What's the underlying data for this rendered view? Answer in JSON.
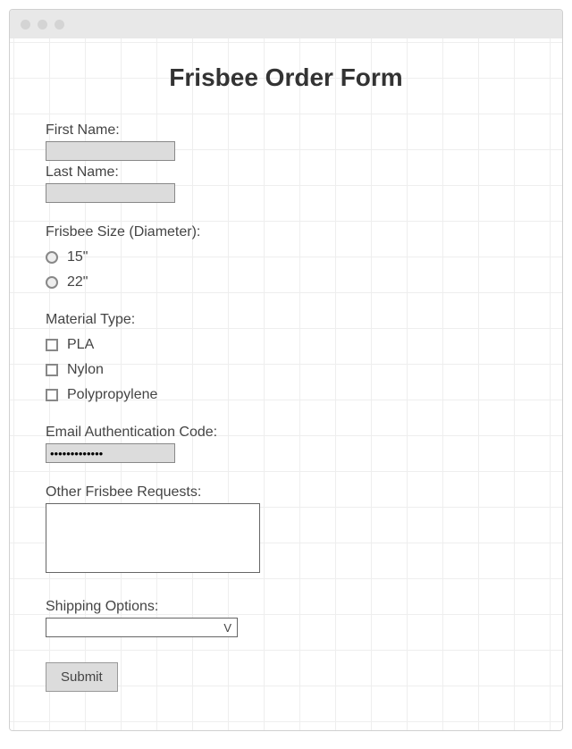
{
  "title": "Frisbee Order Form",
  "fields": {
    "firstName": {
      "label": "First Name:",
      "value": ""
    },
    "lastName": {
      "label": "Last Name:",
      "value": ""
    },
    "size": {
      "label": "Frisbee Size (Diameter):",
      "options": [
        "15\"",
        "22\""
      ]
    },
    "material": {
      "label": "Material Type:",
      "options": [
        "PLA",
        "Nylon",
        "Polypropylene"
      ]
    },
    "authCode": {
      "label": "Email Authentication Code:",
      "value": "•••••••••••••"
    },
    "requests": {
      "label": "Other Frisbee Requests:",
      "value": ""
    },
    "shipping": {
      "label": "Shipping Options:",
      "selected": "",
      "caret": "V"
    }
  },
  "submitLabel": "Submit"
}
